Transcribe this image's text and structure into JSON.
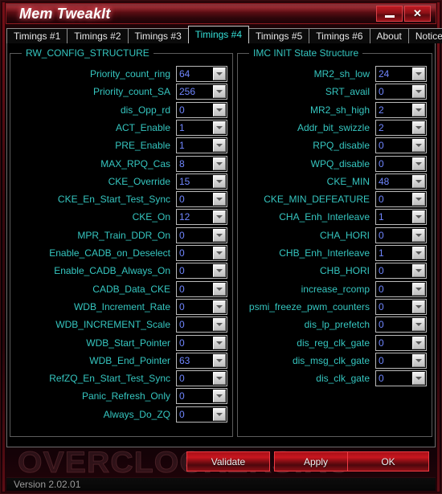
{
  "window": {
    "title": "Mem TweakIt",
    "minimize_label": "minimize",
    "close_label": "✕"
  },
  "tabs": [
    {
      "label": "Timings #1",
      "active": false
    },
    {
      "label": "Timings #2",
      "active": false
    },
    {
      "label": "Timings #3",
      "active": false
    },
    {
      "label": "Timings #4",
      "active": true
    },
    {
      "label": "Timings #5",
      "active": false
    },
    {
      "label": "Timings #6",
      "active": false
    },
    {
      "label": "About",
      "active": false
    },
    {
      "label": "Notice",
      "active": false
    }
  ],
  "left_group": {
    "title": "RW_CONFIG_STRUCTURE",
    "rows": [
      {
        "label": "Priority_count_ring",
        "value": "64"
      },
      {
        "label": "Priority_count_SA",
        "value": "256"
      },
      {
        "label": "dis_Opp_rd",
        "value": "0"
      },
      {
        "label": "ACT_Enable",
        "value": "1"
      },
      {
        "label": "PRE_Enable",
        "value": "1"
      },
      {
        "label": "MAX_RPQ_Cas",
        "value": "8"
      },
      {
        "label": "CKE_Override",
        "value": "15"
      },
      {
        "label": "CKE_En_Start_Test_Sync",
        "value": "0"
      },
      {
        "label": "CKE_On",
        "value": "12"
      },
      {
        "label": "MPR_Train_DDR_On",
        "value": "0"
      },
      {
        "label": "Enable_CADB_on_Deselect",
        "value": "0"
      },
      {
        "label": "Enable_CADB_Always_On",
        "value": "0"
      },
      {
        "label": "CADB_Data_CKE",
        "value": "0"
      },
      {
        "label": "WDB_Increment_Rate",
        "value": "0"
      },
      {
        "label": "WDB_INCREMENT_Scale",
        "value": "0"
      },
      {
        "label": "WDB_Start_Pointer",
        "value": "0"
      },
      {
        "label": "WDB_End_Pointer",
        "value": "63"
      },
      {
        "label": "RefZQ_En_Start_Test_Sync",
        "value": "0"
      },
      {
        "label": "Panic_Refresh_Only",
        "value": "0"
      },
      {
        "label": "Always_Do_ZQ",
        "value": "0"
      }
    ]
  },
  "right_group": {
    "title": "IMC INIT State Structure",
    "rows": [
      {
        "label": "MR2_sh_low",
        "value": "24"
      },
      {
        "label": "SRT_avail",
        "value": "0"
      },
      {
        "label": "MR2_sh_high",
        "value": "2"
      },
      {
        "label": "Addr_bit_swizzle",
        "value": "2"
      },
      {
        "label": "RPQ_disable",
        "value": "0"
      },
      {
        "label": "WPQ_disable",
        "value": "0"
      },
      {
        "label": "CKE_MIN",
        "value": "48"
      },
      {
        "label": "CKE_MIN_DEFEATURE",
        "value": "0"
      },
      {
        "label": "CHA_Enh_Interleave",
        "value": "1"
      },
      {
        "label": "CHA_HORI",
        "value": "0"
      },
      {
        "label": "CHB_Enh_Interleave",
        "value": "1"
      },
      {
        "label": "CHB_HORI",
        "value": "0"
      },
      {
        "label": "increase_rcomp",
        "value": "0"
      },
      {
        "label": "psmi_freeze_pwm_counters",
        "value": "0"
      },
      {
        "label": "dis_lp_prefetch",
        "value": "0"
      },
      {
        "label": "dis_reg_clk_gate",
        "value": "0"
      },
      {
        "label": "dis_msg_clk_gate",
        "value": "0"
      },
      {
        "label": "dis_clk_gate",
        "value": "0"
      }
    ]
  },
  "buttons": {
    "validate": "Validate",
    "apply": "Apply",
    "ok": "OK"
  },
  "watermark": "OVERCLOCKERS.RU",
  "statusbar": {
    "version": "Version 2.02.01"
  },
  "colors": {
    "accent_red": "#c8161f",
    "label_teal": "#35c6c0",
    "value_blue": "#6f86ff",
    "active_tab_text": "#35e0d8"
  }
}
